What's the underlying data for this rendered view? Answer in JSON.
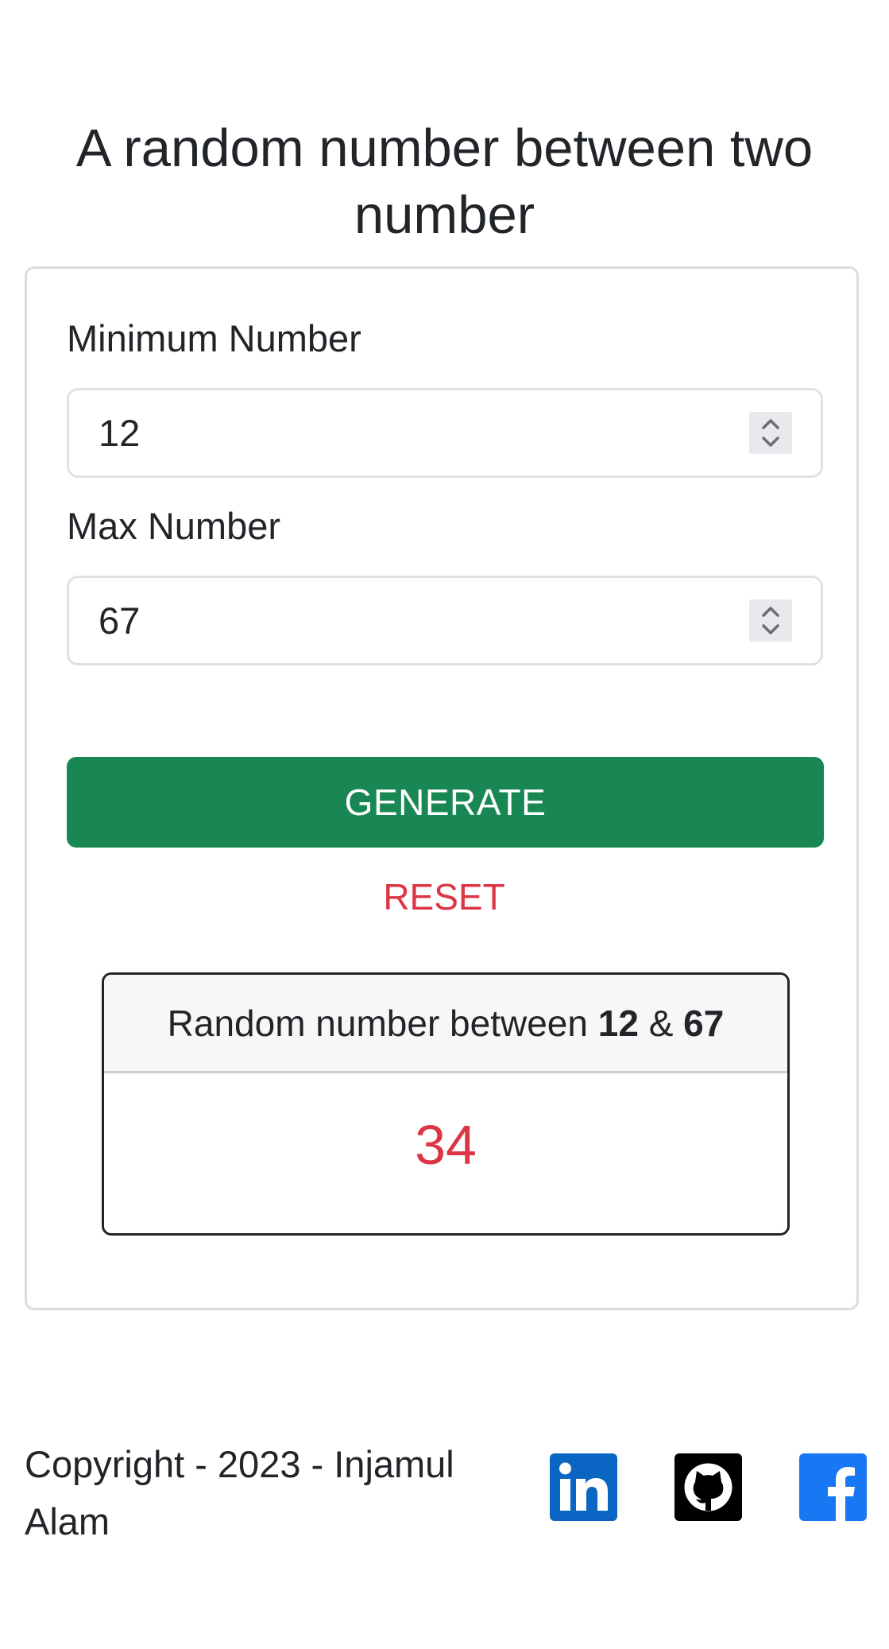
{
  "page": {
    "title": "A random number between two number"
  },
  "form": {
    "min": {
      "label": "Minimum Number",
      "value": "12"
    },
    "max": {
      "label": "Max Number",
      "value": "67"
    },
    "generate_label": "GENERATE",
    "reset_label": "RESET"
  },
  "result": {
    "prefix": "Random number between",
    "min": "12",
    "separator": "&",
    "max": "67",
    "value": "34"
  },
  "footer": {
    "copyright": "Copyright - 2023 - Injamul Alam",
    "social": [
      {
        "icon": "linkedin-icon",
        "color": "#0a66c2"
      },
      {
        "icon": "github-icon",
        "color": "#000000"
      },
      {
        "icon": "facebook-icon",
        "color": "#1877f2"
      }
    ]
  },
  "colors": {
    "success": "#198754",
    "danger": "#dc3545",
    "text": "#212529"
  }
}
